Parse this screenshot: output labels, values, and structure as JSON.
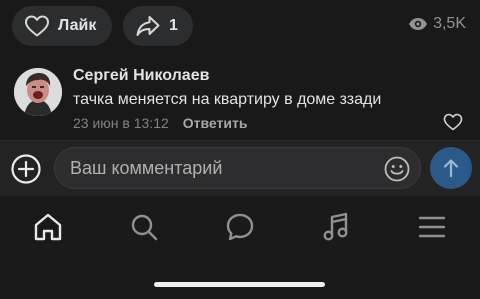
{
  "post_actions": {
    "like_label": "Лайк",
    "share_count": "1",
    "views_count": "3,5K"
  },
  "comment": {
    "author": "Сергей Николаев",
    "text": "тачка меняется на квартиру в доме ззади",
    "date": "23 июн в 13:12",
    "reply_label": "Ответить"
  },
  "composer": {
    "placeholder": "Ваш комментарий"
  },
  "tabbar": {
    "items": [
      "home-icon",
      "search-icon",
      "messages-icon",
      "music-icon",
      "menu-icon"
    ]
  },
  "colors": {
    "background": "#191919",
    "pill": "#2c2d2e",
    "send_button": "#2b5a8a",
    "text_primary": "#e1e3e6",
    "text_secondary": "#828282"
  }
}
